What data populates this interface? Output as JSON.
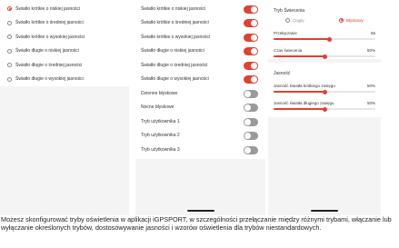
{
  "screen1": {
    "options": [
      {
        "label": "Światło krótkie o niskiej jasności",
        "selected": true
      },
      {
        "label": "Światło krótkie o średniej jasności",
        "selected": false
      },
      {
        "label": "Światło krótkie o wysokiej jasności",
        "selected": false
      },
      {
        "label": "Światło długie o niskiej jasności",
        "selected": false
      },
      {
        "label": "Światło długie o średniej jasności",
        "selected": false
      },
      {
        "label": "Światło długie o wysokiej jasności",
        "selected": false
      }
    ]
  },
  "screen2": {
    "items": [
      {
        "label": "Światło krótkie o niskiej jasności",
        "on": true
      },
      {
        "label": "Światło krótkie o średniej jasności",
        "on": true
      },
      {
        "label": "Światło krótkie o wysokiej jasności",
        "on": true
      },
      {
        "label": "Światło długie o niskiej jasności",
        "on": true
      },
      {
        "label": "Światło długie o średniej jasności",
        "on": true
      },
      {
        "label": "Światło długie o wysokiej jasności",
        "on": true
      },
      {
        "label": "Dzienne błyskowe",
        "on": false
      },
      {
        "label": "Nocne błyskowe",
        "on": false
      },
      {
        "label": "Tryb użytkownika 1",
        "on": false
      },
      {
        "label": "Tryb użytkownika 2",
        "on": false
      },
      {
        "label": "Tryb użytkownika 3",
        "on": false
      }
    ]
  },
  "screen3": {
    "mode_title": "Tryb Świecenia",
    "mode_options": [
      "Ciągły",
      "Błyskowy"
    ],
    "mode_selected": "Błyskowy",
    "flash": {
      "speed_label": "Przełączanie",
      "speed_value": "55",
      "speed_fraction": 0.55,
      "time_label": "Czas świecenia",
      "time_value": "50%",
      "time_fraction": 0.5
    },
    "brightness_title": "Jasność",
    "brightness": {
      "low_label": "Jasność światła krótkiego zasięgu",
      "low_value": "50%",
      "low_fraction": 0.5,
      "high_label": "Jasność światła długiego zasięgu",
      "high_value": "50%",
      "high_fraction": 0.5
    }
  },
  "caption": "Możesz skonfigurować tryby oświetlenia w aplikacji iGPSPORT, w szczególności przełączanie między różnymi trybami, włączanie lub wyłączanie określonych trybów, dostosowywanie jasności i wzorów oświetlenia dla trybów niestandardowych.",
  "colors": {
    "accent": "#e3402f",
    "off": "#9a9a9a"
  }
}
